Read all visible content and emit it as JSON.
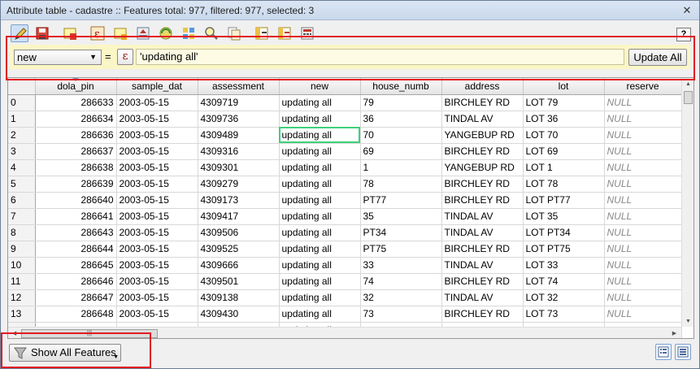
{
  "window": {
    "title": "Attribute table - cadastre :: Features total: 977, filtered: 977, selected: 3",
    "close_glyph": "✕"
  },
  "toolbar": {
    "buttons": [
      "toggle-editing-icon",
      "save-edits-icon",
      "delete-selected-icon",
      "select-by-expression-icon",
      "select-all-icon",
      "move-selection-top-icon",
      "invert-selection-icon",
      "deselect-all-icon",
      "zoom-to-selection-icon",
      "copy-rows-icon",
      "new-column-icon",
      "delete-column-icon",
      "field-calculator-icon"
    ],
    "help_label": "?"
  },
  "calculator": {
    "field_value": "new",
    "equals": "=",
    "expression_button": "ε",
    "expression_value": "'updating all'",
    "update_all_label": "Update All"
  },
  "table": {
    "columns": [
      "dola_pin",
      "sample_dat",
      "assessment",
      "new",
      "house_numb",
      "address",
      "lot",
      "reserve"
    ],
    "rows": [
      {
        "id": "0",
        "dola_pin": "286633",
        "sample_dat": "2003-05-15",
        "assessment": "4309719",
        "new": "updating all",
        "house_numb": "79",
        "address": "BIRCHLEY RD",
        "lot": "LOT 79",
        "reserve": "NULL"
      },
      {
        "id": "1",
        "dola_pin": "286634",
        "sample_dat": "2003-05-15",
        "assessment": "4309736",
        "new": "updating all",
        "house_numb": "36",
        "address": "TINDAL AV",
        "lot": "LOT 36",
        "reserve": "NULL"
      },
      {
        "id": "2",
        "dola_pin": "286636",
        "sample_dat": "2003-05-15",
        "assessment": "4309489",
        "new": "updating all",
        "house_numb": "70",
        "address": "YANGEBUP RD",
        "lot": "LOT 70",
        "reserve": "NULL"
      },
      {
        "id": "3",
        "dola_pin": "286637",
        "sample_dat": "2003-05-15",
        "assessment": "4309316",
        "new": "updating all",
        "house_numb": "69",
        "address": "BIRCHLEY RD",
        "lot": "LOT 69",
        "reserve": "NULL"
      },
      {
        "id": "4",
        "dola_pin": "286638",
        "sample_dat": "2003-05-15",
        "assessment": "4309301",
        "new": "updating all",
        "house_numb": "1",
        "address": "YANGEBUP RD",
        "lot": "LOT 1",
        "reserve": "NULL"
      },
      {
        "id": "5",
        "dola_pin": "286639",
        "sample_dat": "2003-05-15",
        "assessment": "4309279",
        "new": "updating all",
        "house_numb": "78",
        "address": "BIRCHLEY RD",
        "lot": "LOT 78",
        "reserve": "NULL"
      },
      {
        "id": "6",
        "dola_pin": "286640",
        "sample_dat": "2003-05-15",
        "assessment": "4309173",
        "new": "updating all",
        "house_numb": "PT77",
        "address": "BIRCHLEY RD",
        "lot": "LOT PT77",
        "reserve": "NULL"
      },
      {
        "id": "7",
        "dola_pin": "286641",
        "sample_dat": "2003-05-15",
        "assessment": "4309417",
        "new": "updating all",
        "house_numb": "35",
        "address": "TINDAL AV",
        "lot": "LOT 35",
        "reserve": "NULL"
      },
      {
        "id": "8",
        "dola_pin": "286643",
        "sample_dat": "2003-05-15",
        "assessment": "4309506",
        "new": "updating all",
        "house_numb": "PT34",
        "address": "TINDAL AV",
        "lot": "LOT PT34",
        "reserve": "NULL"
      },
      {
        "id": "9",
        "dola_pin": "286644",
        "sample_dat": "2003-05-15",
        "assessment": "4309525",
        "new": "updating all",
        "house_numb": "PT75",
        "address": "BIRCHLEY RD",
        "lot": "LOT PT75",
        "reserve": "NULL"
      },
      {
        "id": "10",
        "dola_pin": "286645",
        "sample_dat": "2003-05-15",
        "assessment": "4309666",
        "new": "updating all",
        "house_numb": "33",
        "address": "TINDAL AV",
        "lot": "LOT 33",
        "reserve": "NULL"
      },
      {
        "id": "11",
        "dola_pin": "286646",
        "sample_dat": "2003-05-15",
        "assessment": "4309501",
        "new": "updating all",
        "house_numb": "74",
        "address": "BIRCHLEY RD",
        "lot": "LOT 74",
        "reserve": "NULL"
      },
      {
        "id": "12",
        "dola_pin": "286647",
        "sample_dat": "2003-05-15",
        "assessment": "4309138",
        "new": "updating all",
        "house_numb": "32",
        "address": "TINDAL AV",
        "lot": "LOT 32",
        "reserve": "NULL"
      },
      {
        "id": "13",
        "dola_pin": "286648",
        "sample_dat": "2003-05-15",
        "assessment": "4309430",
        "new": "updating all",
        "house_numb": "73",
        "address": "BIRCHLEY RD",
        "lot": "LOT 73",
        "reserve": "NULL"
      },
      {
        "id": "",
        "dola_pin": "",
        "sample_dat": "",
        "assessment": "",
        "new": "updating all",
        "house_numb": "",
        "address": "",
        "lot": "",
        "reserve": ""
      }
    ],
    "focused_cell": {
      "row": 2,
      "column": "new"
    },
    "hscroll_thumb_label": "|||"
  },
  "bottom": {
    "show_features_label": "Show All Features",
    "view_buttons": [
      "table-view-icon",
      "form-view-icon"
    ]
  },
  "colors": {
    "highlight": "#e21b22",
    "calc_bar": "#fbf6c5",
    "focus": "#3ed17a"
  }
}
